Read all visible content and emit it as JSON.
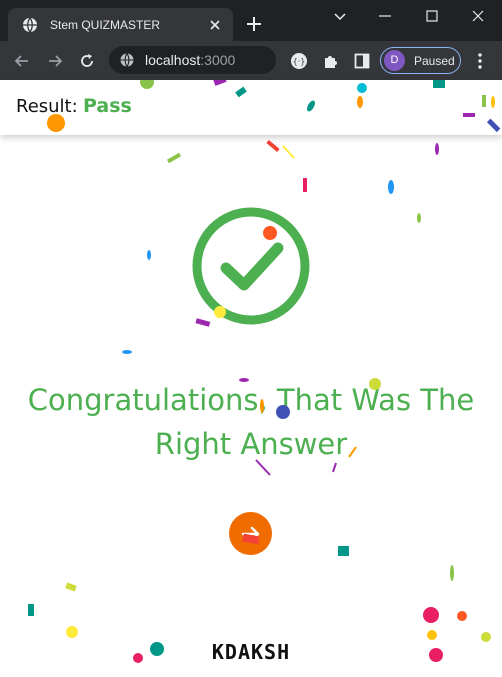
{
  "browser": {
    "tab_title": "Stem QUIZMASTER",
    "url_host": "localhost",
    "url_port": ":3000",
    "profile_initial": "D",
    "profile_status": "Paused",
    "avatar_color": "#7e57c2"
  },
  "result": {
    "label": "Result:",
    "value": "Pass",
    "color": "#4caf50"
  },
  "main": {
    "message_line1": "Congratulations, That Was The",
    "message_line2": "Right Answer",
    "next_button_icon": "arrow-right-icon",
    "next_button_color": "#f06c00",
    "brand": "KDAKSH"
  }
}
